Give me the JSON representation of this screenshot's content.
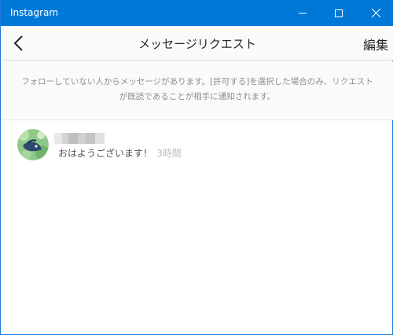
{
  "window": {
    "title": "Instagram",
    "controls": [
      "minimize-icon",
      "maximize-icon",
      "close-icon"
    ],
    "accent_color": "#0078d7"
  },
  "navbar": {
    "back_icon": "chevron-left-icon",
    "title": "メッセージリクエスト",
    "edit_label": "編集"
  },
  "notice": {
    "text": "フォローしていない人からメッセージがあります。[許可する]を選択した場合のみ、リクエストが既読であることが相手に通知されます。"
  },
  "requests": [
    {
      "sender_name_visible": false,
      "message": "おはようございます！",
      "time": "3時間"
    }
  ]
}
